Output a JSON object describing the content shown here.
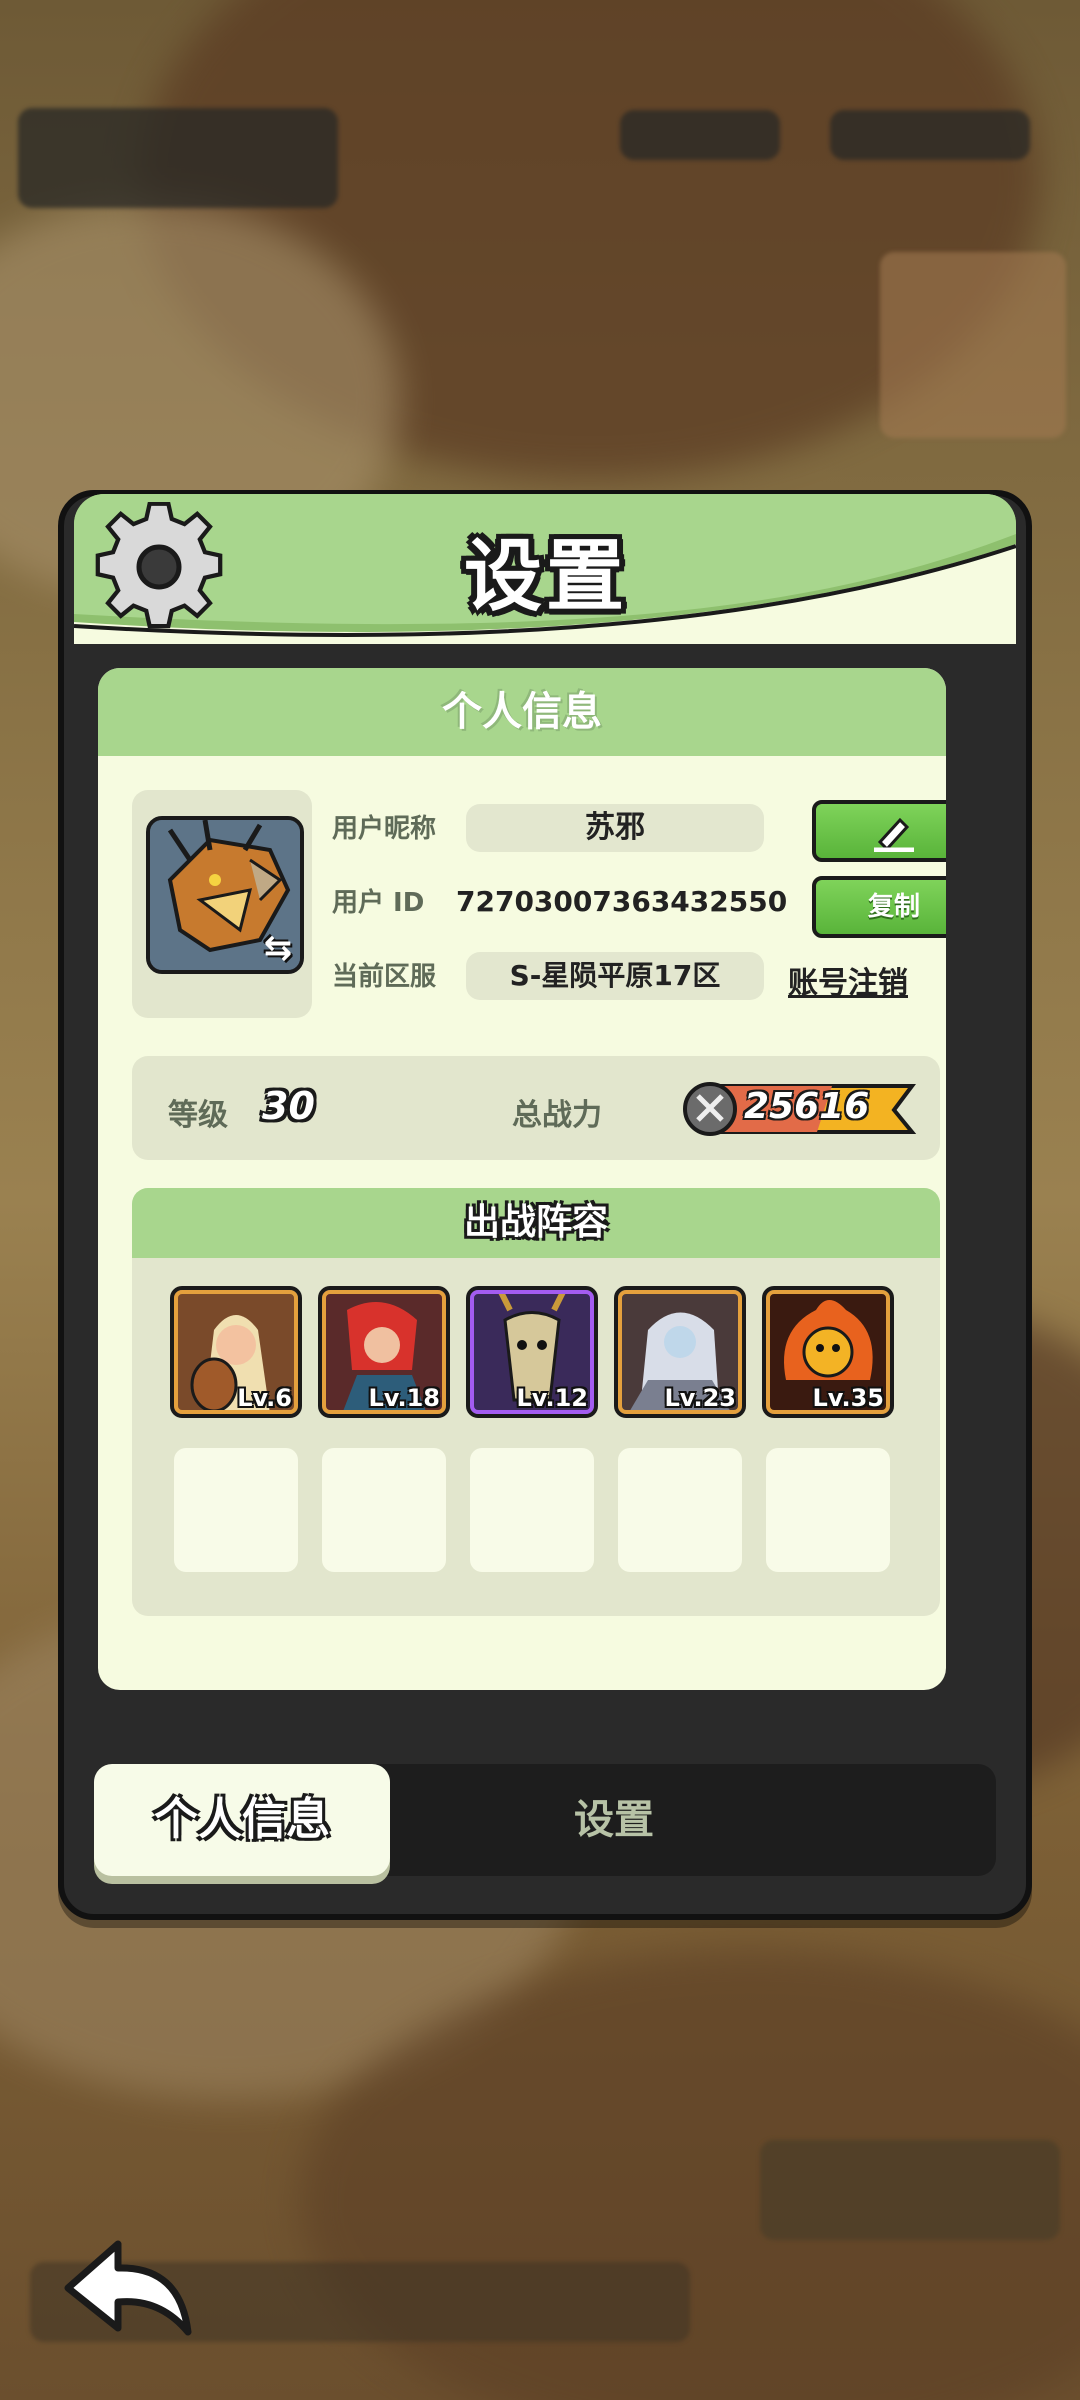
{
  "dialog": {
    "title": "设置"
  },
  "panel": {
    "header": "个人信息"
  },
  "profile": {
    "nickname_label": "用户昵称",
    "nickname": "苏邪",
    "uid_label": "用户  ID",
    "uid": "72703007363432550",
    "server_label": "当前区服",
    "server": "S-星陨平原17区",
    "copy_button": "复制",
    "deregister_link": "账号注销",
    "edit_icon": "pencil-icon"
  },
  "stats": {
    "level_label": "等级",
    "level": "30",
    "power_label": "总战力",
    "power": "25616"
  },
  "lineup": {
    "header": "出战阵容",
    "heroes": [
      {
        "level": "Lv.6",
        "frame": "gold"
      },
      {
        "level": "Lv.18",
        "frame": "gold"
      },
      {
        "level": "Lv.12",
        "frame": "purple"
      },
      {
        "level": "Lv.23",
        "frame": "gold"
      },
      {
        "level": "Lv.35",
        "frame": "gold"
      }
    ]
  },
  "tabs": [
    {
      "label": "个人信息",
      "active": true
    },
    {
      "label": "设置",
      "active": false
    }
  ],
  "colors": {
    "accent_green": "#a8d68d",
    "button_green": "#6cc44a",
    "panel_bg": "#f6fbe0"
  }
}
